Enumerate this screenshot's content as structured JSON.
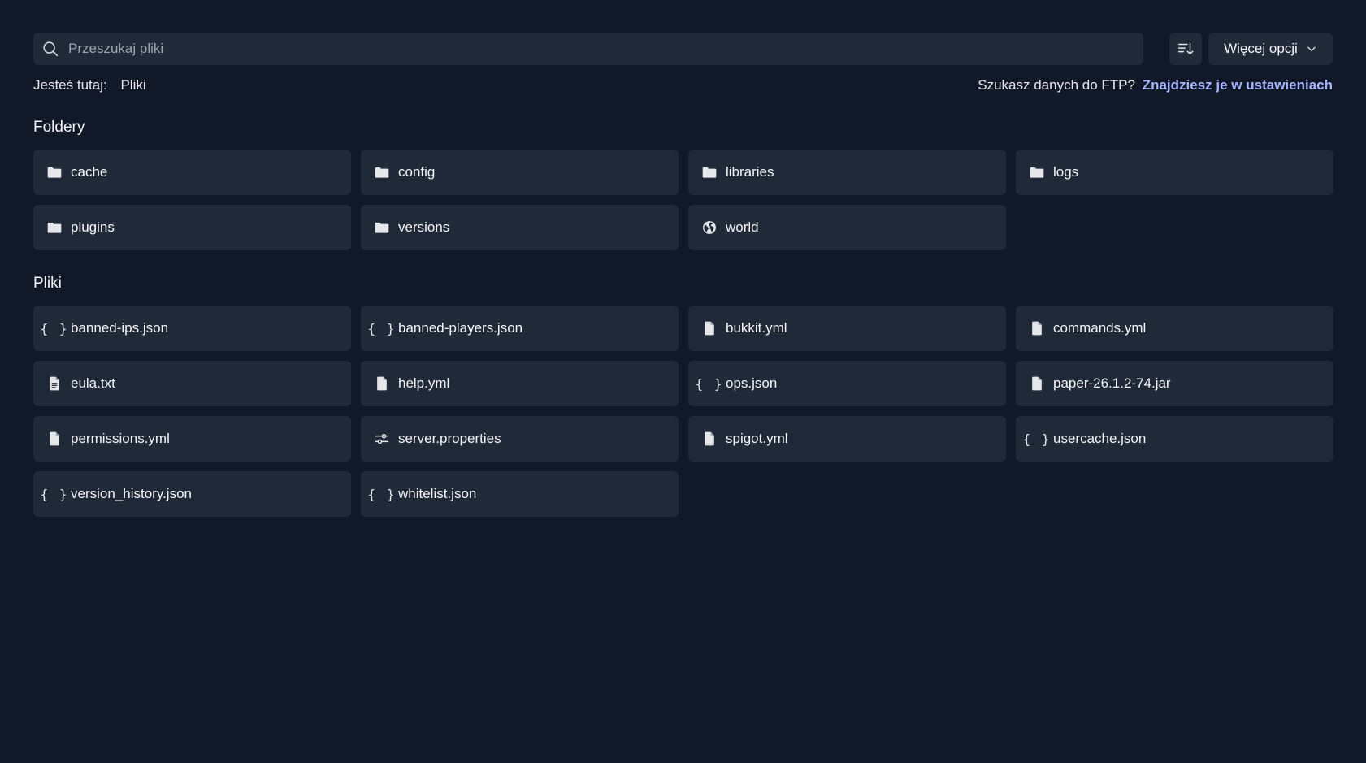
{
  "search": {
    "placeholder": "Przeszukaj pliki"
  },
  "toolbar": {
    "more_label": "Więcej opcji"
  },
  "breadcrumb": {
    "prefix": "Jesteś tutaj:",
    "current": "Pliki"
  },
  "ftp": {
    "question": "Szukasz danych do FTP?",
    "link": "Znajdziesz je w ustawieniach"
  },
  "sections": {
    "folders_title": "Foldery",
    "files_title": "Pliki"
  },
  "folders": [
    {
      "name": "cache",
      "icon": "folder-icon"
    },
    {
      "name": "config",
      "icon": "folder-icon"
    },
    {
      "name": "libraries",
      "icon": "folder-icon"
    },
    {
      "name": "logs",
      "icon": "folder-icon"
    },
    {
      "name": "plugins",
      "icon": "folder-icon"
    },
    {
      "name": "versions",
      "icon": "folder-icon"
    },
    {
      "name": "world",
      "icon": "globe-icon"
    }
  ],
  "files": [
    {
      "name": "banned-ips.json",
      "icon": "json-icon"
    },
    {
      "name": "banned-players.json",
      "icon": "json-icon"
    },
    {
      "name": "bukkit.yml",
      "icon": "file-icon"
    },
    {
      "name": "commands.yml",
      "icon": "file-icon"
    },
    {
      "name": "eula.txt",
      "icon": "text-file-icon"
    },
    {
      "name": "help.yml",
      "icon": "file-icon"
    },
    {
      "name": "ops.json",
      "icon": "json-icon"
    },
    {
      "name": "paper-26.1.2-74.jar",
      "icon": "file-icon"
    },
    {
      "name": "permissions.yml",
      "icon": "file-icon"
    },
    {
      "name": "server.properties",
      "icon": "sliders-icon"
    },
    {
      "name": "spigot.yml",
      "icon": "file-icon"
    },
    {
      "name": "usercache.json",
      "icon": "json-icon"
    },
    {
      "name": "version_history.json",
      "icon": "json-icon"
    },
    {
      "name": "whitelist.json",
      "icon": "json-icon"
    }
  ],
  "colors": {
    "background": "#111827",
    "tile": "#1f2937",
    "link": "#a5b4fc"
  }
}
